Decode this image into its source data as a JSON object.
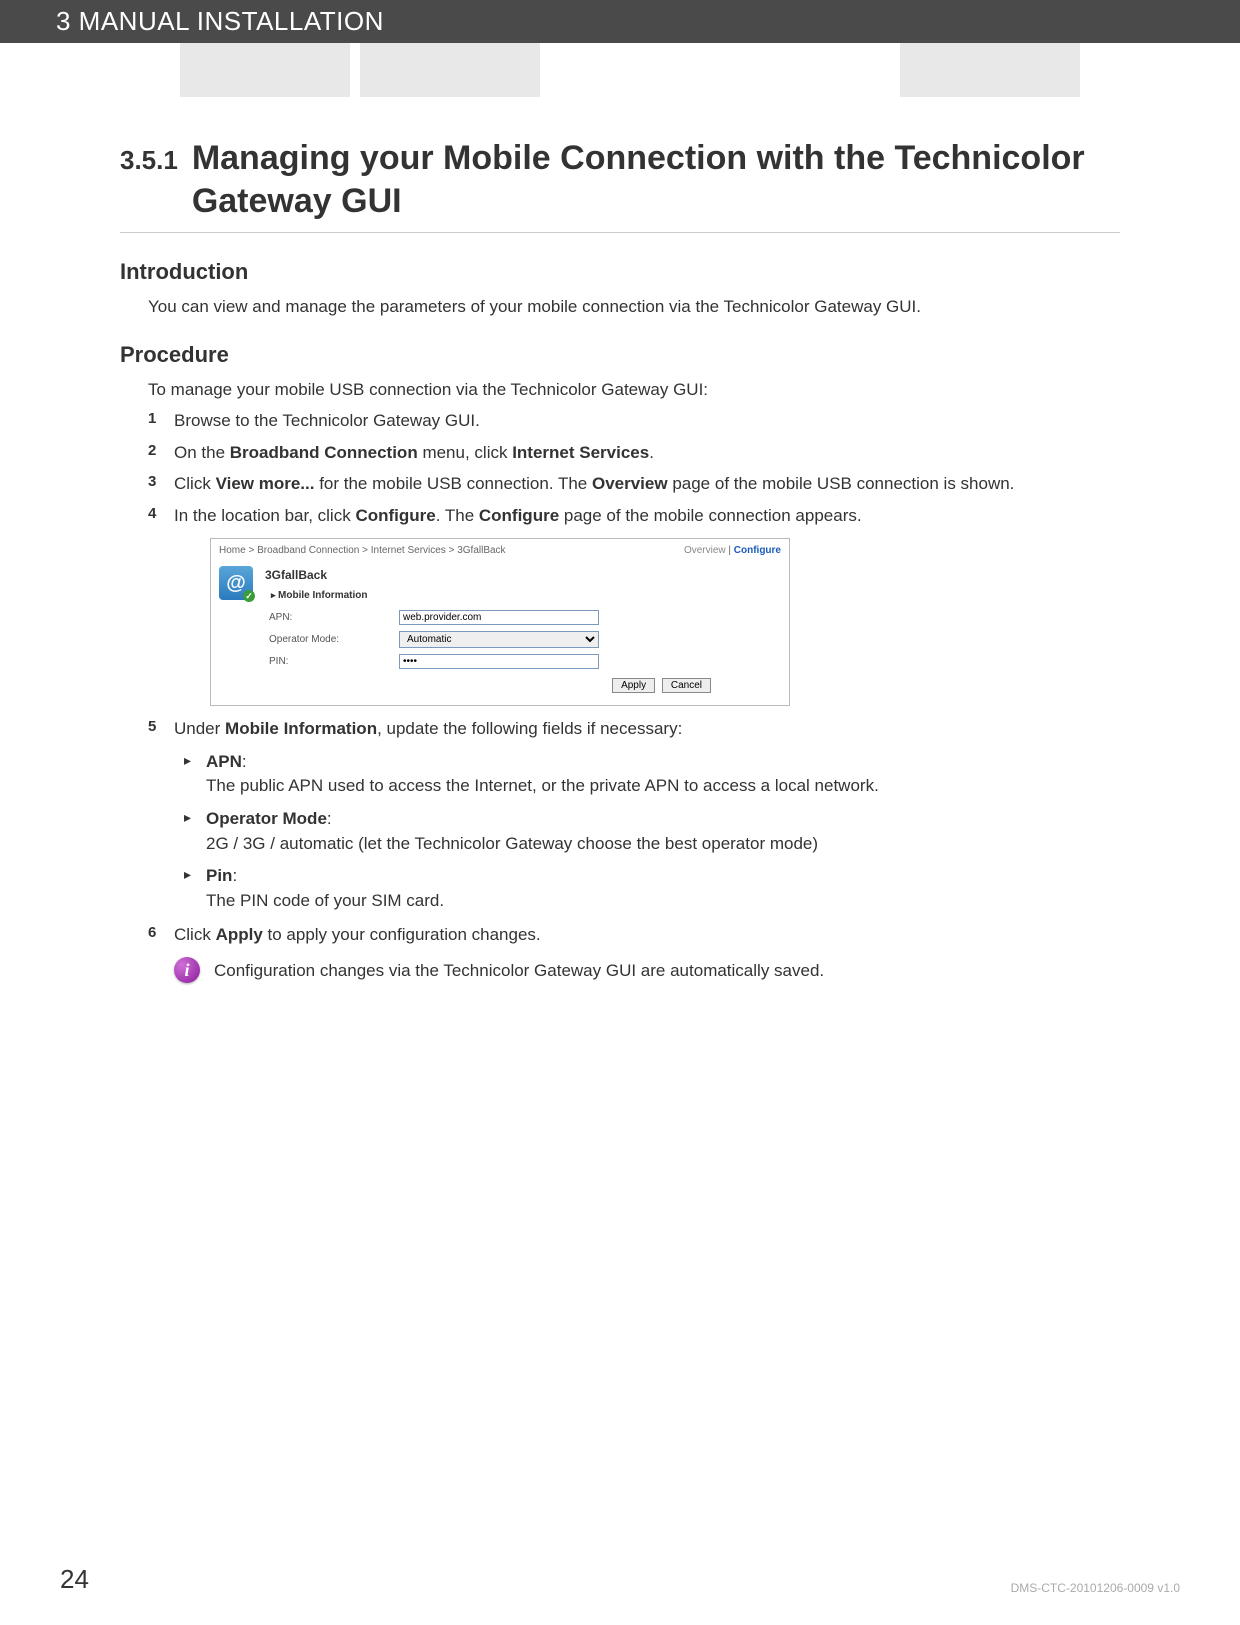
{
  "header": {
    "chapter": "3 MANUAL INSTALLATION"
  },
  "section": {
    "number": "3.5.1",
    "title": "Managing your Mobile Connection with the Technicolor Gateway GUI"
  },
  "intro": {
    "heading": "Introduction",
    "text": "You can view and manage the parameters of your mobile connection via the Technicolor Gateway GUI."
  },
  "procedure": {
    "heading": "Procedure",
    "lead": "To manage your mobile USB connection via the Technicolor Gateway GUI:",
    "steps": {
      "s1": "Browse to the Technicolor Gateway GUI.",
      "s2_a": "On the ",
      "s2_b": "Broadband Connection",
      "s2_c": " menu, click ",
      "s2_d": "Internet Services",
      "s2_e": ".",
      "s3_a": "Click ",
      "s3_b": "View more...",
      "s3_c": " for the mobile USB connection. The ",
      "s3_d": "Overview",
      "s3_e": " page of the mobile USB connection is shown.",
      "s4_a": "In the location bar, click ",
      "s4_b": "Configure",
      "s4_c": ". The ",
      "s4_d": "Configure",
      "s4_e": " page of the mobile connection appears.",
      "s5_a": "Under ",
      "s5_b": "Mobile Information",
      "s5_c": ", update the following fields if necessary:",
      "s6_a": "Click ",
      "s6_b": "Apply",
      "s6_c": " to apply your configuration changes."
    },
    "fields": {
      "apn_t": "APN",
      "apn_d": "The public APN used to access the Internet, or the private APN to access a local network.",
      "op_t": "Operator Mode",
      "op_d": "2G / 3G / automatic (let the Technicolor Gateway choose the best operator mode)",
      "pin_t": "Pin",
      "pin_d": "The PIN code of your SIM card."
    }
  },
  "gui": {
    "breadcrumb": "Home > Broadband Connection > Internet Services > 3GfallBack",
    "tab_overview": "Overview",
    "tab_sep": " | ",
    "tab_configure": "Configure",
    "title": "3GfallBack",
    "section": "Mobile Information",
    "labels": {
      "apn": "APN:",
      "op": "Operator Mode:",
      "pin": "PIN:"
    },
    "values": {
      "apn": "web.provider.com",
      "op": "Automatic",
      "pin": "••••"
    },
    "buttons": {
      "apply": "Apply",
      "cancel": "Cancel"
    }
  },
  "note": "Configuration changes via the Technicolor Gateway GUI are automatically saved.",
  "footer": {
    "page": "24",
    "docid": "DMS-CTC-20101206-0009 v1.0"
  }
}
